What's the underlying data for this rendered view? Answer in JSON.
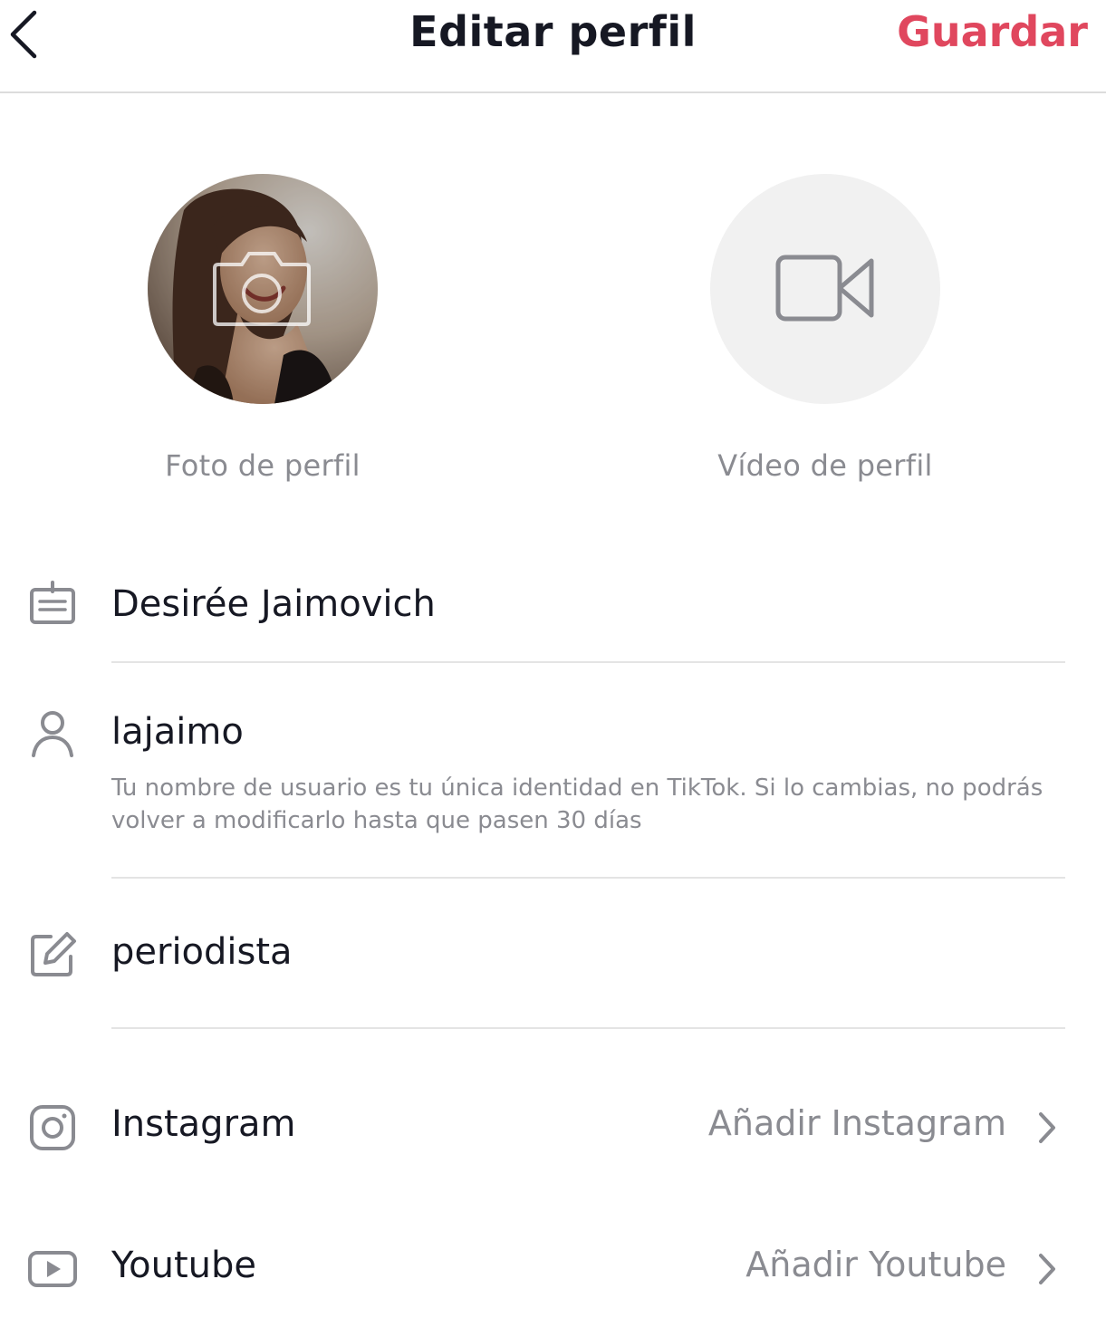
{
  "header": {
    "title": "Editar perfil",
    "save_label": "Guardar",
    "accent_color": "#e0475e"
  },
  "avatars": {
    "photo_label": "Foto de perfil",
    "video_label": "Vídeo de perfil"
  },
  "fields": {
    "name": {
      "value": "Desirée Jaimovich",
      "icon": "id-card-icon"
    },
    "username": {
      "value": "lajaimo",
      "icon": "person-icon",
      "hint": "Tu nombre de usuario es tu única identidad en TikTok. Si lo cambias, no podrás volver a modificarlo hasta que pasen 30 días"
    },
    "bio": {
      "value": "periodista",
      "icon": "edit-icon"
    }
  },
  "social": [
    {
      "label": "Instagram",
      "action": "Añadir Instagram",
      "icon": "instagram-icon"
    },
    {
      "label": "Youtube",
      "action": "Añadir Youtube",
      "icon": "youtube-icon"
    }
  ]
}
